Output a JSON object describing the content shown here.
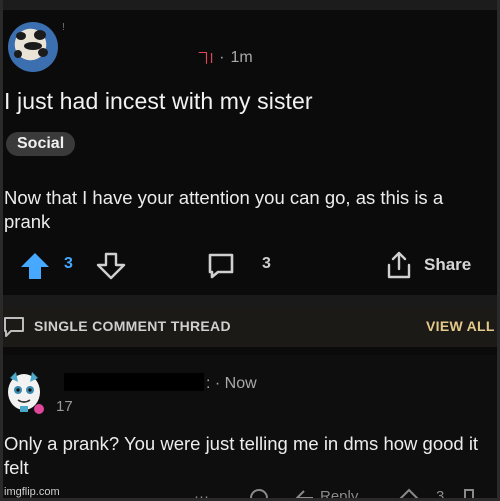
{
  "post": {
    "user_glyph": "!",
    "subreddit_mark": "ヿl",
    "time_separator": "·",
    "time": "1m",
    "title": "I just had incest with my sister",
    "flair": "Social",
    "body": "Now that I have your attention you can go, as this is a prank",
    "upvotes": "3",
    "comments": "3",
    "share_label": "Share",
    "icons": [
      "upvote-icon",
      "downvote-icon",
      "comment-icon",
      "share-icon"
    ],
    "upvote_color": "#46a8ff"
  },
  "thread_bar": {
    "label": "SINGLE COMMENT THREAD",
    "view_all": "VIEW ALL",
    "accent_color": "#e3c98a"
  },
  "comment": {
    "meta_tail": ": · Now",
    "score": "17",
    "text": "Only a prank? You were just telling me in dms how good it felt",
    "reply_label": "Reply",
    "vote_count": "3"
  },
  "watermark": "imgflip.com"
}
